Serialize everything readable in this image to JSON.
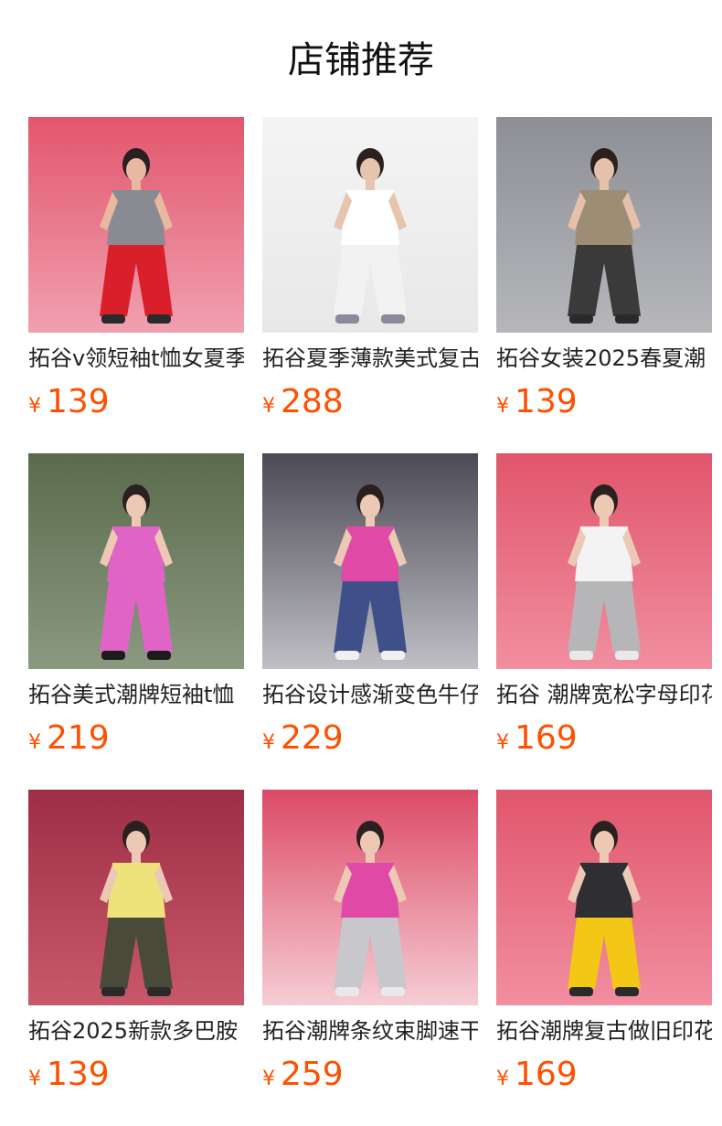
{
  "section": {
    "title": "店铺推荐"
  },
  "products": [
    {
      "title": "拓谷v领短袖t恤女夏季",
      "currency": "¥",
      "price": "139",
      "bg_top": "#e2566d",
      "bg_bottom": "#f0a0b0",
      "top_color": "#8a8a92",
      "bottom_color": "#d81f2a",
      "skin": "#e8b8a0",
      "shoe": "#2a2a2a"
    },
    {
      "title": "拓谷夏季薄款美式复古",
      "currency": "¥",
      "price": "288",
      "bg_top": "#f4f4f4",
      "bg_bottom": "#e8e8e8",
      "top_color": "#ffffff",
      "bottom_color": "#f2f2f2",
      "skin": "#e7c4ad",
      "shoe": "#8a8a9a"
    },
    {
      "title": "拓谷女装2025春夏潮",
      "currency": "¥",
      "price": "139",
      "bg_top": "#8d8f95",
      "bg_bottom": "#b6b7bb",
      "top_color": "#9c8d74",
      "bottom_color": "#3a3a3a",
      "skin": "#e6c1a9",
      "shoe": "#2a2a2a"
    },
    {
      "title": "拓谷美式潮牌短袖t恤",
      "currency": "¥",
      "price": "219",
      "bg_top": "#5a6a4c",
      "bg_bottom": "#8a9a80",
      "top_color": "#e064c6",
      "bottom_color": "#e064c6",
      "skin": "#ecc8b5",
      "shoe": "#1c1c1c"
    },
    {
      "title": "拓谷设计感渐变色牛仔",
      "currency": "¥",
      "price": "229",
      "bg_top": "#4b4a55",
      "bg_bottom": "#bfbfc5",
      "top_color": "#e04aa6",
      "bottom_color": "#3f4f8a",
      "skin": "#ecc8b5",
      "shoe": "#f0f0f0"
    },
    {
      "title": "拓谷 潮牌宽松字母印花",
      "currency": "¥",
      "price": "169",
      "bg_top": "#e0566c",
      "bg_bottom": "#f18ea0",
      "top_color": "#f3f3f3",
      "bottom_color": "#b6b6b8",
      "skin": "#ecc8b5",
      "shoe": "#e9e9e9"
    },
    {
      "title": "拓谷2025新款多巴胺",
      "currency": "¥",
      "price": "139",
      "bg_top": "#9e2e46",
      "bg_bottom": "#c9586a",
      "top_color": "#ede37a",
      "bottom_color": "#4a4a3a",
      "skin": "#ecc8b5",
      "shoe": "#2a2a2a"
    },
    {
      "title": "拓谷潮牌条纹束脚速干",
      "currency": "¥",
      "price": "259",
      "bg_top": "#dc4a66",
      "bg_bottom": "#f6cdd4",
      "top_color": "#e04aa6",
      "bottom_color": "#c8c8cc",
      "skin": "#ecc8b5",
      "shoe": "#e9e9e9"
    },
    {
      "title": "拓谷潮牌复古做旧印花",
      "currency": "¥",
      "price": "169",
      "bg_top": "#e0566c",
      "bg_bottom": "#f18ea0",
      "top_color": "#2e2e33",
      "bottom_color": "#f2c715",
      "skin": "#ecc8b5",
      "shoe": "#2a2a2a"
    }
  ]
}
